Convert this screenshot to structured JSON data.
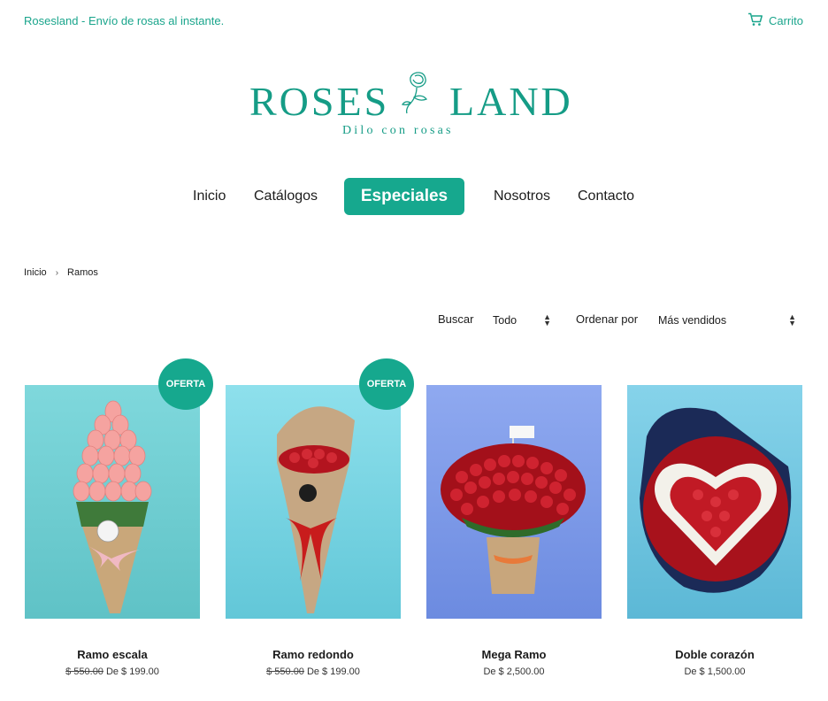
{
  "header": {
    "tagline": "Rosesland - Envío de rosas al instante.",
    "cart_label": "Carrito",
    "cart_icon": "cart-icon"
  },
  "logo": {
    "left_word": "ROSES",
    "right_word": "LAND",
    "subtitle": "Dilo con rosas",
    "brand_color": "#159c86"
  },
  "nav": {
    "items": [
      "Inicio",
      "Catálogos",
      "Especiales",
      "Nosotros",
      "Contacto"
    ],
    "active_color": "#16a88e"
  },
  "breadcrumb": {
    "home": "Inicio",
    "separator": "›",
    "current": "Ramos"
  },
  "filters": {
    "search_label": "Buscar",
    "search_value": "Todo",
    "sort_label": "Ordenar por",
    "sort_value": "Más vendidos"
  },
  "products": [
    {
      "name": "Ramo escala",
      "old_price": "$ 550.00",
      "price": "De $ 199.00",
      "badge": "OFERTA"
    },
    {
      "name": "Ramo redondo",
      "old_price": "$ 550.00",
      "price": "De $ 199.00",
      "badge": "OFERTA"
    },
    {
      "name": "Mega Ramo",
      "old_price": "",
      "price": "De $ 2,500.00",
      "badge": ""
    },
    {
      "name": "Doble corazón",
      "old_price": "",
      "price": "De $ 1,500.00",
      "badge": ""
    }
  ]
}
